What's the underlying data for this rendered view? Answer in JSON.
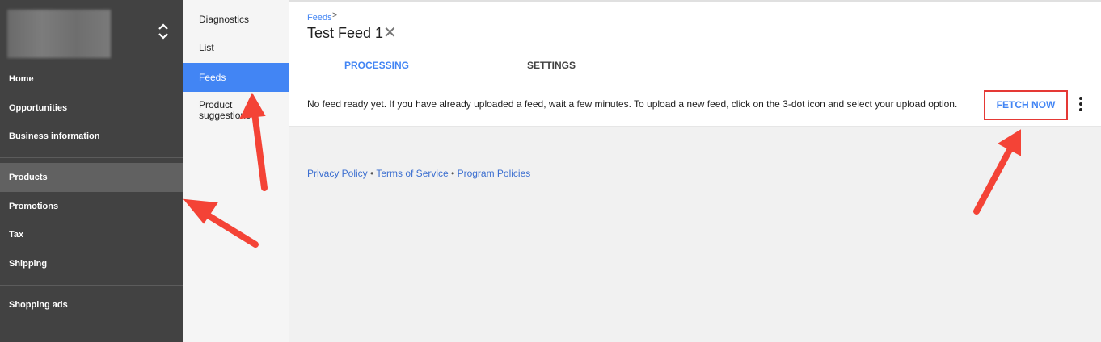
{
  "leftnav": {
    "items": [
      {
        "label": "Home"
      },
      {
        "label": "Opportunities"
      },
      {
        "label": "Business information"
      },
      {
        "label": "Products"
      },
      {
        "label": "Promotions"
      },
      {
        "label": "Tax"
      },
      {
        "label": "Shipping"
      },
      {
        "label": "Shopping ads"
      }
    ],
    "active": "Products"
  },
  "subnav": {
    "items": [
      {
        "label": "Diagnostics"
      },
      {
        "label": "List"
      },
      {
        "label": "Feeds"
      },
      {
        "label": "Product suggestions"
      }
    ],
    "active": "Feeds"
  },
  "header": {
    "breadcrumb": "Feeds",
    "breadcrumb_sep": ">",
    "title": "Test Feed 1",
    "close_glyph": "✕"
  },
  "tabs": [
    {
      "label": "PROCESSING",
      "active": true
    },
    {
      "label": "SETTINGS",
      "active": false
    }
  ],
  "notice": {
    "text": "No feed ready yet. If you have already uploaded a feed, wait a few minutes. To upload a new feed, click on the 3-dot icon and select your upload option.",
    "fetch_label": "FETCH NOW"
  },
  "footer": {
    "privacy": "Privacy Policy",
    "sep1": " • ",
    "terms": "Terms of Service",
    "sep2": " • ",
    "program": "Program Policies"
  },
  "colors": {
    "accent": "#4285f4",
    "nav_bg": "#424242",
    "annotation": "#e53935"
  },
  "icons": [
    "unfold-more-icon",
    "close-icon",
    "more-vert-icon"
  ]
}
